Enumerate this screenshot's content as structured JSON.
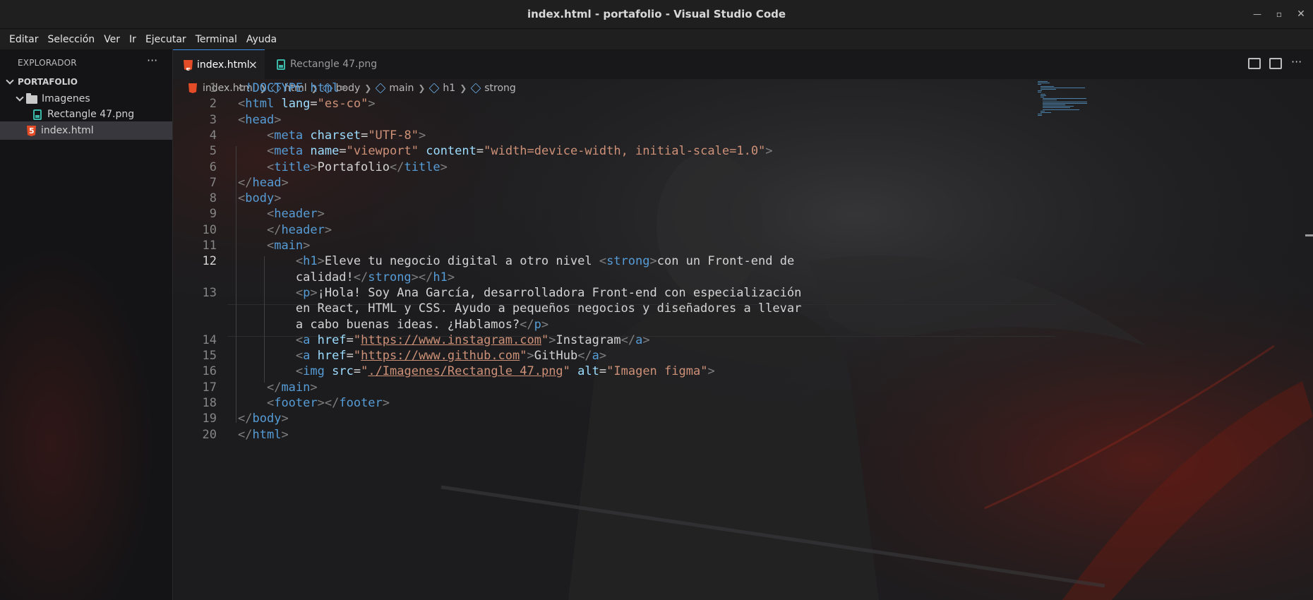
{
  "window": {
    "title": "index.html - portafolio - Visual Studio Code"
  },
  "menu": [
    "Editar",
    "Selección",
    "Ver",
    "Ir",
    "Ejecutar",
    "Terminal",
    "Ayuda"
  ],
  "sidebar": {
    "header": "EXPLORADOR",
    "more": "···",
    "root": "PORTAFOLIO",
    "items": [
      {
        "label": "Imagenes",
        "type": "folder"
      },
      {
        "label": "Rectangle 47.png",
        "type": "image"
      },
      {
        "label": "index.html",
        "type": "html",
        "selected": true
      }
    ]
  },
  "tabs": [
    {
      "label": "index.html",
      "active": true,
      "close": "×"
    },
    {
      "label": "Rectangle 47.png",
      "active": false
    }
  ],
  "breadcrumb": [
    "index.html",
    "html",
    "body",
    "main",
    "h1",
    "strong"
  ],
  "editor": {
    "line_numbers": [
      "1",
      "2",
      "3",
      "4",
      "5",
      "6",
      "7",
      "8",
      "9",
      "10",
      "11",
      "12",
      "13",
      "14",
      "15",
      "16",
      "17",
      "18",
      "19",
      "20"
    ],
    "active_line": "12",
    "lines": [
      "<!DOCTYPE html>",
      "<html lang=\"es-co\">",
      "<head>",
      "    <meta charset=\"UTF-8\">",
      "    <meta name=\"viewport\" content=\"width=device-width, initial-scale=1.0\">",
      "    <title>Portafolio</title>",
      "</head>",
      "<body>",
      "    <header>",
      "    </header>",
      "    <main>",
      "        <h1>Eleve tu negocio digital a otro nivel <strong>con un Front-end de",
      "        calidad!</strong></h1>",
      "        <p>¡Hola! Soy Ana García, desarrolladora Front-end con especialización",
      "        en React, HTML y CSS. Ayudo a pequeños negocios y diseñadores a llevar",
      "        a cabo buenas ideas. ¿Hablamos?</p>",
      "        <a href=\"https://www.instagram.com\">Instagram</a>",
      "        <a href=\"https://www.github.com\">GitHub</a>",
      "        <img src=\"./Imagenes/Rectangle 47.png\" alt=\"Imagen figma\">",
      "    </main>",
      "    <footer></footer>",
      "</body>",
      "</html>"
    ]
  }
}
